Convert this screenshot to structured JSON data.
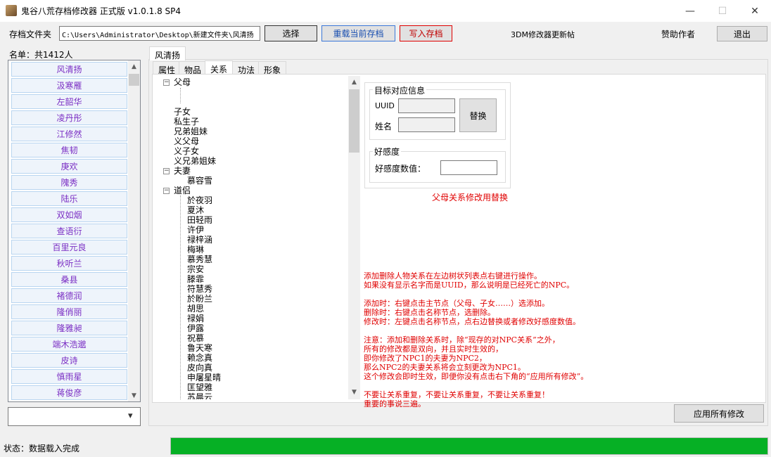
{
  "window": {
    "title": "鬼谷八荒存档修改器 正式版 v1.0.1.8 SP4",
    "minimize": "—",
    "maximize": "☐",
    "close": "✕"
  },
  "toolbar": {
    "folder_label": "存档文件夹",
    "folder_path": "C:\\Users\\Administrator\\Desktop\\新建文件夹\\风清扬",
    "select_label": "选择",
    "reload_label": "重载当前存档",
    "write_label": "写入存档",
    "update_link": "3DM修改器更新帖",
    "sponsor_link": "赞助作者",
    "exit_label": "退出"
  },
  "colors": {
    "reload_border": "#3c78d8",
    "write_border": "#e00000",
    "list_text": "#7b2fc4",
    "progress": "#06b025"
  },
  "sidebar": {
    "count_label": "名单：共1412人",
    "items": [
      "风清扬",
      "汲寒雁",
      "左韶华",
      "凌丹彤",
      "江修然",
      "焦韧",
      "庚欢",
      "隗秀",
      "陆乐",
      "双如烟",
      "查语衍",
      "百里元良",
      "秋听兰",
      "桑县",
      "褚德润",
      "隆俏丽",
      "隆雅昶",
      "端木浩邈",
      "皮诗",
      "慎雨星",
      "蒋俊彦"
    ],
    "combo_value": ""
  },
  "character_tab": "风清扬",
  "tabs": [
    "属性",
    "物品",
    "关系",
    "功法",
    "形象"
  ],
  "active_tab": "关系",
  "tree": {
    "parents": "父母",
    "children_label": "子女",
    "illegitimate": "私生子",
    "siblings": "兄弟姐妹",
    "adoptive_parents": "义父母",
    "adoptive_children": "义子女",
    "sworn_siblings": "义兄弟姐妹",
    "spouse": "夫妻",
    "spouse_members": [
      "慕容雪"
    ],
    "dao_partner": "道侣",
    "dao_members": [
      "於夜羽",
      "夏沐",
      "田轻雨",
      "许伊",
      "禄梓涵",
      "梅琳",
      "慕秀慧",
      "宗安",
      "滕霏",
      "符慧秀",
      "於盼兰",
      "胡思",
      "禄娟",
      "伊露",
      "祝慕",
      "鲁天寒",
      "赖念真",
      "皮向真",
      "申屠星晴",
      "匡望雅",
      "苏晨云"
    ]
  },
  "target_info": {
    "title": "目标对应信息",
    "uuid_label": "UUID",
    "uuid_value": "",
    "name_label": "姓名",
    "name_value": "",
    "replace_label": "替换"
  },
  "favor": {
    "title": "好感度",
    "value_label": "好感度数值：",
    "value": ""
  },
  "hint_parent": "父母关系修改用替换",
  "instructions": [
    "添加删除人物关系在左边树状列表点右键进行操作。",
    "如果没有显示名字而是UUID，那么说明是已经死亡的NPC。",
    "",
    "添加时：右键点击主节点（父母、子女……）选添加。",
    "删除时：右键点击名称节点，选删除。",
    "修改时：左键点击名称节点，点右边替换或者修改好感度数值。",
    "",
    "注意：添加和删除关系时，除“现存的对NPC关系”之外，",
    "所有的修改都是双向，并且实时生效的，",
    "即你修改了NPC1的夫妻为NPC2，",
    "那么NPC2的夫妻关系将会立刻更改为NPC1。",
    "这个修改会即时生效，即便你没有点击右下角的“应用所有修改”。",
    "",
    "不要让关系重复，不要让关系重复，不要让关系重复！",
    "重要的事说三遍。"
  ],
  "apply_label": "应用所有修改",
  "status": {
    "text": "状态：数据载入完成",
    "progress_percent": 100
  },
  "icons": {
    "scroll_up": "▲",
    "scroll_down": "▼",
    "combo_arrow": "▾",
    "tree_minus": "−"
  }
}
